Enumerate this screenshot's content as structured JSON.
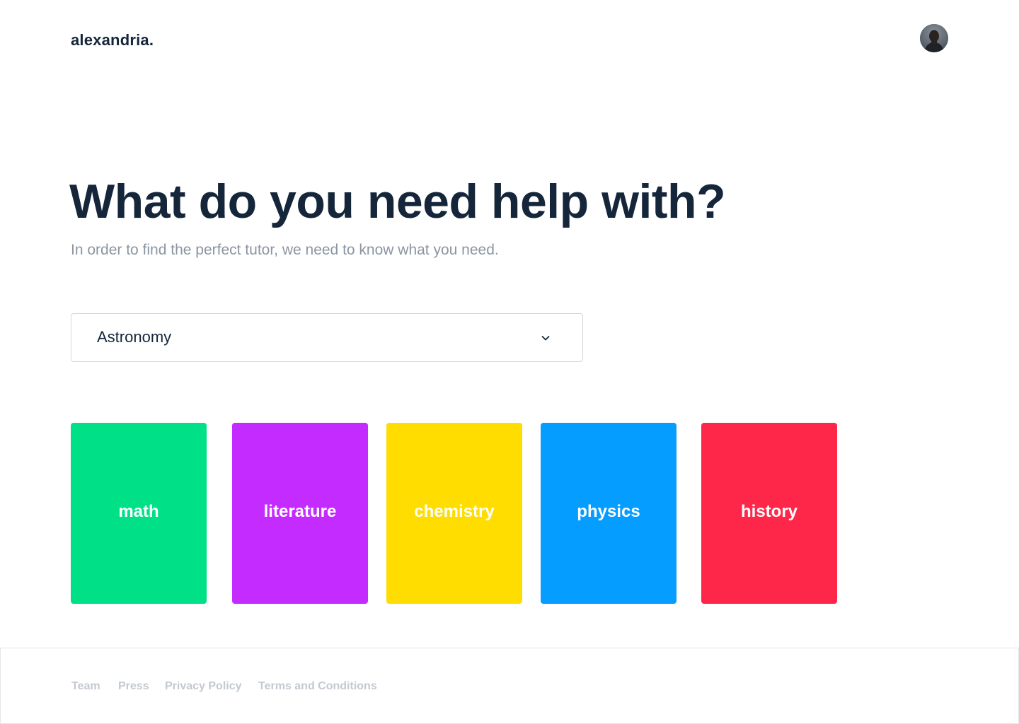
{
  "header": {
    "logo": "alexandria.",
    "avatar_label": "user avatar"
  },
  "hero": {
    "title": "What do you need help with?",
    "subtitle": "In order to find the perfect tutor, we need to know what you need."
  },
  "subject_select": {
    "selected": "Astronomy",
    "icon": "chevron-down-icon"
  },
  "subjects": [
    {
      "label": "math",
      "color": "#00e187"
    },
    {
      "label": "literature",
      "color": "#c32bff"
    },
    {
      "label": "chemistry",
      "color": "#ffdd00"
    },
    {
      "label": "physics",
      "color": "#059dff"
    },
    {
      "label": "history",
      "color": "#ff2749"
    }
  ],
  "footer": {
    "links": [
      "Team",
      "Press",
      "Privacy Policy",
      "Terms and Conditions"
    ]
  }
}
